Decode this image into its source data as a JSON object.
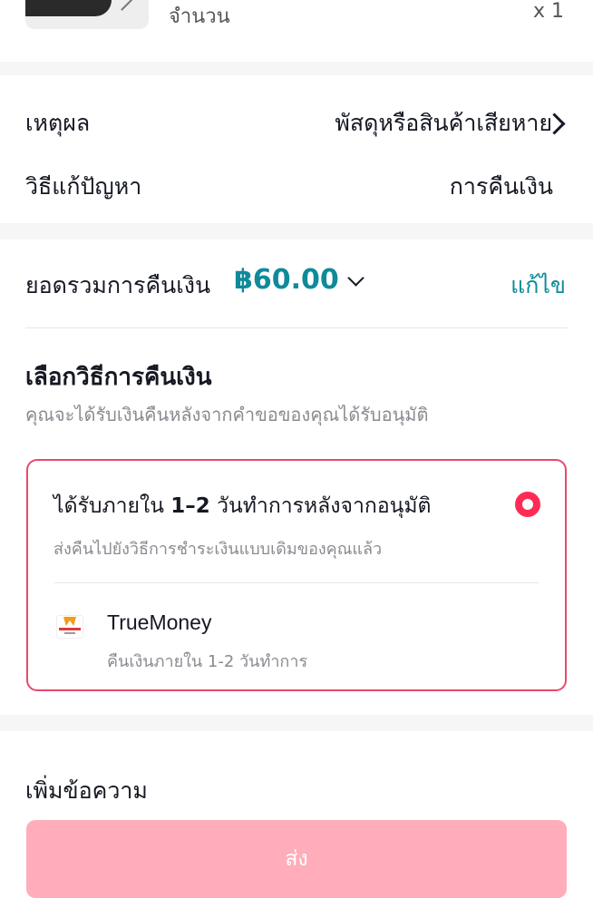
{
  "product": {
    "qty_label": "จำนวน",
    "qty_value": "x 1"
  },
  "reason": {
    "label": "เหตุผล",
    "value": "พัสดุหรือสินค้าเสียหาย",
    "solution_label": "วิธีแก้ปัญหา",
    "solution_value": "การคืนเงิน"
  },
  "refund": {
    "total_label": "ยอดรวมการคืนเงิน",
    "total_amount": "฿60.00",
    "edit_label": "แก้ไข",
    "choose_title": "เลือกวิธีการคืนเงิน",
    "choose_sub": "คุณจะได้รับเงินคืนหลังจากคำขอของคุณได้รับอนุมัติ",
    "option": {
      "title_prefix": "ได้รับภายใน ",
      "title_bold": "1–2",
      "title_suffix": " วันทำการหลังจากอนุมัติ",
      "subtitle": "ส่งคืนไปยังวิธีการชำระเงินแบบเดิมของคุณแล้ว",
      "selected": true,
      "method_name": "TrueMoney",
      "method_sub": "คืนเงินภายใน 1-2 วันทำการ",
      "method_icon": "truemoney-wallet-logo"
    }
  },
  "message": {
    "label": "เพิ่มข้อความ",
    "send_label": "ส่ง"
  },
  "colors": {
    "accent_teal": "#0f8a9a",
    "primary_pink": "#fe2c55",
    "button_disabled": "#ffadbb",
    "card_border": "#e64a6a"
  }
}
